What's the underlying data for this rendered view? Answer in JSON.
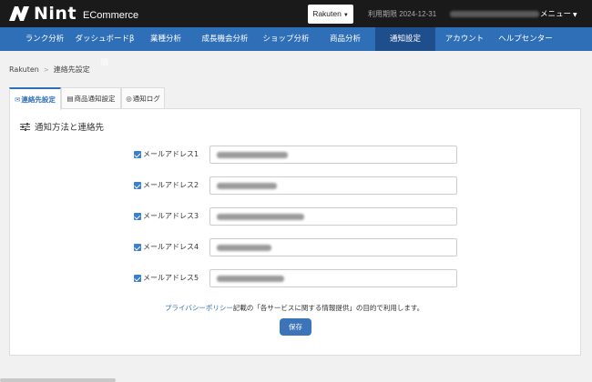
{
  "header": {
    "logo_text": "Nint",
    "logo_sub": "ECommerce",
    "shop": "Rakuten",
    "period": "利用期限 2024-12-31",
    "user_menu": "メニュー"
  },
  "nav": [
    {
      "label": "ランク分析",
      "active": false
    },
    {
      "label": "ダッシュボードβ版",
      "active": false
    },
    {
      "label": "業種分析",
      "active": false
    },
    {
      "label": "成長機会分析",
      "active": false
    },
    {
      "label": "ショップ分析",
      "active": false
    },
    {
      "label": "商品分析",
      "active": false
    },
    {
      "label": "通知設定",
      "active": true
    },
    {
      "label": "アカウント",
      "active": false
    },
    {
      "label": "ヘルプセンター",
      "active": false
    }
  ],
  "breadcrumb": {
    "root": "Rakuten",
    "current": "連絡先設定"
  },
  "tabs": [
    {
      "label": "連絡先設定",
      "icon": "envelope-icon",
      "active": true
    },
    {
      "label": "商品通知設定",
      "icon": "table-icon",
      "active": false
    },
    {
      "label": "通知ログ",
      "icon": "bell-icon",
      "active": false
    }
  ],
  "panel": {
    "title": "通知方法と連絡先"
  },
  "emails": [
    {
      "label": "メールアドレス1",
      "checked": true
    },
    {
      "label": "メールアドレス2",
      "checked": true
    },
    {
      "label": "メールアドレス3",
      "checked": true
    },
    {
      "label": "メールアドレス4",
      "checked": true
    },
    {
      "label": "メールアドレス5",
      "checked": true
    }
  ],
  "privacy": {
    "link": "プライバシーポリシー",
    "text": "記載の「各サービスに関する情報提供」の目的で利用します。"
  },
  "save_label": "保存",
  "colors": {
    "topbar": "#1a1a1a",
    "nav": "#2f6fb8",
    "nav_active": "#1f4e8c",
    "accent": "#2f6fb8",
    "button": "#3b74b8"
  }
}
